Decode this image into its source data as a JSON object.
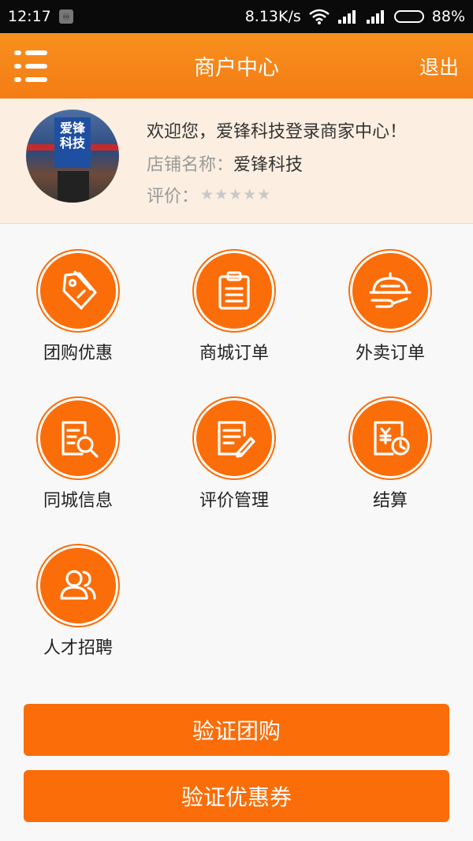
{
  "status_bar": {
    "time": "12:17",
    "net_speed": "8.13K/s",
    "battery": "88%",
    "battery_level": 0.88
  },
  "header": {
    "title": "商户中心",
    "logout": "退出",
    "color": "#f7861a"
  },
  "profile": {
    "welcome": "欢迎您，爱锋科技登录商家中心！",
    "shop_name_label": "店铺名称：",
    "shop_name": "爱锋科技",
    "rating_label": "评价：",
    "rating": 0,
    "rating_max": 5,
    "avatar_sign": "爱锋科技"
  },
  "menu": {
    "items": [
      {
        "label": "团购优惠",
        "icon": "tag-icon"
      },
      {
        "label": "商城订单",
        "icon": "clipboard-icon"
      },
      {
        "label": "外卖订单",
        "icon": "food-cloche-icon"
      },
      {
        "label": "同城信息",
        "icon": "document-search-icon"
      },
      {
        "label": "评价管理",
        "icon": "document-edit-icon"
      },
      {
        "label": "结算",
        "icon": "bill-clock-icon"
      },
      {
        "label": "人才招聘",
        "icon": "people-icon"
      }
    ]
  },
  "buttons": {
    "verify_group": "验证团购",
    "verify_coupon": "验证优惠券"
  },
  "colors": {
    "accent": "#fb6d08",
    "profile_bg": "#fcefe1"
  }
}
